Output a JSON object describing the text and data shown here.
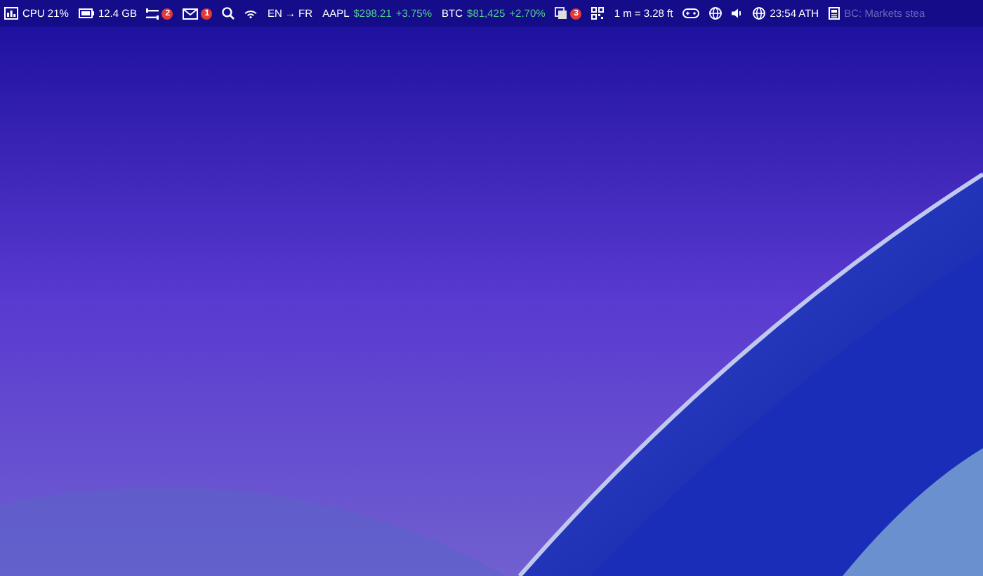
{
  "menu_bar": {
    "items": [
      {
        "kind": "cpu",
        "text": "CPU 21%"
      },
      {
        "kind": "memory",
        "text": "12.4 GB"
      },
      {
        "kind": "tasks",
        "badge": "2"
      },
      {
        "kind": "mail",
        "badge": "1"
      },
      {
        "kind": "search"
      },
      {
        "kind": "wifi"
      },
      {
        "kind": "translate",
        "text": "EN → FR"
      },
      {
        "kind": "stock",
        "symbol": "AAPL",
        "price": "$298.21",
        "change": "+3.75%"
      },
      {
        "kind": "stock",
        "symbol": "BTC",
        "price": "$81,425",
        "change": "+2.70%"
      },
      {
        "kind": "clipboard",
        "badge": "3"
      },
      {
        "kind": "qr"
      },
      {
        "kind": "convert",
        "text": "1 m = 3.28 ft"
      },
      {
        "kind": "gamepad"
      },
      {
        "kind": "vpn"
      },
      {
        "kind": "volume"
      },
      {
        "kind": "clock",
        "text": "23:54 ATH"
      },
      {
        "kind": "news",
        "text": "BC: Markets stea"
      }
    ]
  }
}
